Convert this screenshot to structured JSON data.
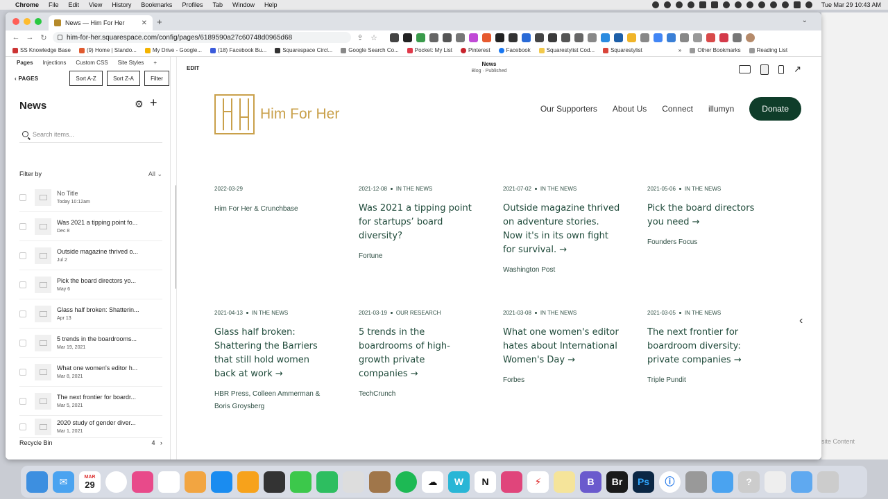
{
  "menubar": {
    "app": "Chrome",
    "items": [
      "File",
      "Edit",
      "View",
      "History",
      "Bookmarks",
      "Profiles",
      "Tab",
      "Window",
      "Help"
    ],
    "clock": "Tue Mar 29  10:43 AM"
  },
  "browser": {
    "tab_title": "News — Him For Her",
    "url": "him-for-her.squarespace.com/config/pages/6189590a27c60748d0965d68",
    "bookmarks": [
      "SS Knowledge Base",
      "(9) Home | Stando...",
      "My Drive - Google...",
      "(18) Facebook Bu...",
      "Squarespace Circl...",
      "Google Search Co...",
      "Pocket: My List",
      "Pinterest",
      "Facebook",
      "Squarestylist Cod...",
      "Squarestylist"
    ],
    "bookmarks_right": [
      "Other Bookmarks",
      "Reading List"
    ]
  },
  "left_panel": {
    "tabs": [
      "Pages",
      "Injections",
      "Custom CSS",
      "Site Styles"
    ],
    "back_label": "PAGES",
    "buttons": [
      "Sort A-Z",
      "Sort Z-A",
      "Filter"
    ],
    "heading": "News",
    "search_placeholder": "Search items...",
    "filter_label": "Filter by",
    "filter_value": "All",
    "items": [
      {
        "title": "No Title",
        "date": "Today 10:12am"
      },
      {
        "title": "Was 2021 a tipping point fo...",
        "date": "Dec 8"
      },
      {
        "title": "Outside magazine thrived o...",
        "date": "Jul 2"
      },
      {
        "title": "Pick the board directors yo...",
        "date": "May 6"
      },
      {
        "title": "Glass half broken: Shatterin...",
        "date": "Apr 13"
      },
      {
        "title": "5 trends in the boardrooms...",
        "date": "Mar 19, 2021"
      },
      {
        "title": "What one women's editor h...",
        "date": "Mar 8, 2021"
      },
      {
        "title": "The next frontier for boardr...",
        "date": "Mar 5, 2021"
      },
      {
        "title": "2020 study of gender diver...",
        "date": "Mar 1, 2021"
      }
    ],
    "recycle_label": "Recycle Bin",
    "recycle_count": "4"
  },
  "preview": {
    "edit_label": "EDIT",
    "page_name": "News",
    "page_status": "Blog · Published"
  },
  "site": {
    "logo_text": "Him For Her",
    "nav": [
      "Our Supporters",
      "About Us",
      "Connect",
      "illumyn"
    ],
    "donate": "Donate",
    "posts": [
      {
        "date": "2022-03-29",
        "category": "",
        "title": "",
        "source": "Him For Her & Crunchbase"
      },
      {
        "date": "2021-12-08",
        "category": "IN THE NEWS",
        "title": "Was 2021 a tipping point for startups’ board diversity?",
        "source": "Fortune"
      },
      {
        "date": "2021-07-02",
        "category": "IN THE NEWS",
        "title": "Outside magazine thrived on adventure stories. Now it's in its own fight for survival. →",
        "source": "Washington Post"
      },
      {
        "date": "2021-05-06",
        "category": "IN THE NEWS",
        "title": "Pick the board directors you need →",
        "source": "Founders Focus"
      },
      {
        "date": "2021-04-13",
        "category": "IN THE NEWS",
        "title": "Glass half broken: Shattering the Barriers that still hold women back at work →",
        "source": "HBR Press,  Colleen Ammerman & Boris Groysberg"
      },
      {
        "date": "2021-03-19",
        "category": "OUR RESEARCH",
        "title": "5 trends in the boardrooms of high-growth private companies →",
        "source": "TechCrunch"
      },
      {
        "date": "2021-03-08",
        "category": "IN THE NEWS",
        "title": "What one women's editor hates about International Women's Day →",
        "source": "Forbes"
      },
      {
        "date": "2021-03-05",
        "category": "IN THE NEWS",
        "title": "The next frontier for boardroom diversity: private companies →",
        "source": "Triple Pundit"
      }
    ]
  },
  "behind_panel": {
    "text": "site Content"
  },
  "dock": {
    "date_badge_month": "MAR",
    "date_badge_day": "29"
  },
  "colors": {
    "brand_gold": "#c9a04a",
    "donate_green": "#0f3d2a",
    "text_green": "#1f4a3a"
  }
}
